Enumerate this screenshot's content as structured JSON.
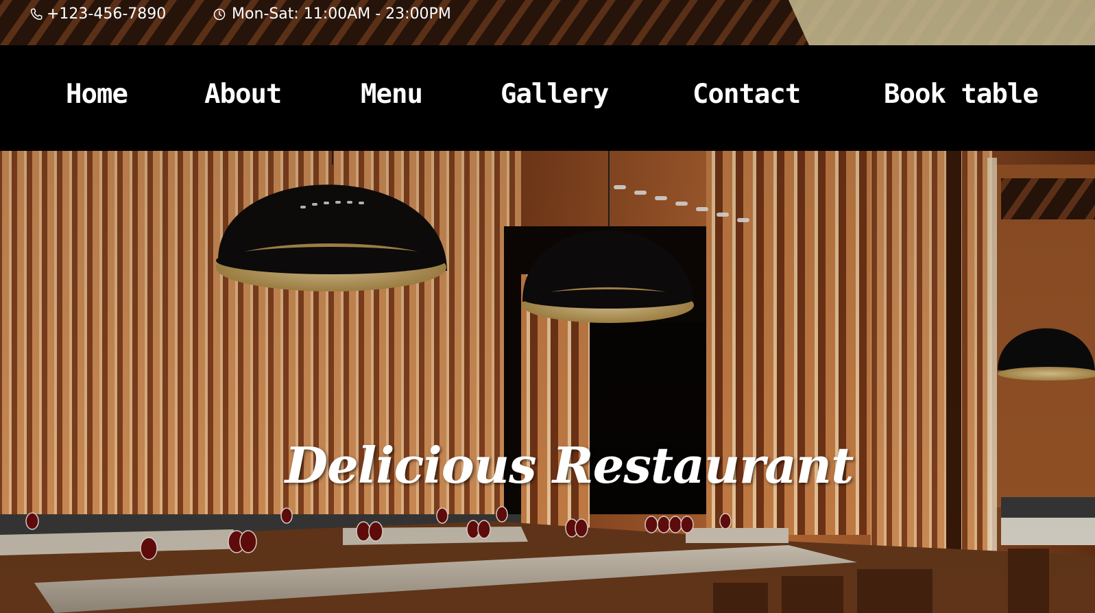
{
  "topbar": {
    "phone_icon": "phone-icon",
    "phone": "+123-456-7890",
    "hours_icon": "clock-icon",
    "hours": "Mon-Sat: 11:00AM - 23:00PM"
  },
  "nav": {
    "items": [
      {
        "label": "Home"
      },
      {
        "label": "About"
      },
      {
        "label": "Menu"
      },
      {
        "label": "Gallery"
      },
      {
        "label": "Contact"
      },
      {
        "label": "Book table"
      }
    ]
  },
  "hero": {
    "title": "Delicious Restaurant"
  },
  "colors": {
    "nav_bg": "#000000",
    "nav_text": "#ffffff",
    "wood": "#c8733a",
    "warm_light": "#f6c38a",
    "lamp": "#0b0b0b"
  }
}
